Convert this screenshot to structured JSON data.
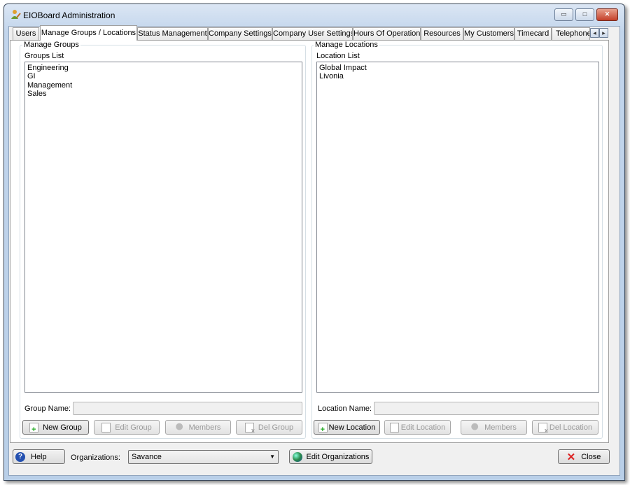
{
  "window": {
    "title": "EIOBoard Administration",
    "controls": {
      "minimize": "▭",
      "maximize": "□",
      "close": "✕"
    }
  },
  "tabs": [
    {
      "label": "Users"
    },
    {
      "label": "Manage Groups / Locations",
      "selected": true
    },
    {
      "label": "Status Management"
    },
    {
      "label": "Company Settings"
    },
    {
      "label": "Company User Settings"
    },
    {
      "label": "Hours Of Operation"
    },
    {
      "label": "Resources"
    },
    {
      "label": "My Customers"
    },
    {
      "label": "Timecard"
    },
    {
      "label": "Telephone"
    }
  ],
  "tab_scroll": {
    "left": "◂",
    "right": "▸"
  },
  "groups": {
    "box_title": "Manage Groups",
    "list_label": "Groups List",
    "items": [
      "Engineering",
      "GI",
      "Management",
      "Sales"
    ],
    "name_label": "Group Name:",
    "name_value": "",
    "buttons": {
      "new": "New Group",
      "edit": "Edit Group",
      "members": "Members",
      "delete": "Del Group"
    }
  },
  "locations": {
    "box_title": "Manage Locations",
    "list_label": "Location List",
    "items": [
      "Global Impact",
      "Livonia"
    ],
    "name_label": "Location Name:",
    "name_value": "",
    "buttons": {
      "new": "New Location",
      "edit": "Edit Location",
      "members": "Members",
      "delete": "Del Location"
    }
  },
  "footer": {
    "help": "Help",
    "org_label": "Organizations:",
    "org_value": "Savance",
    "edit_orgs": "Edit Organizations",
    "close": "Close"
  }
}
